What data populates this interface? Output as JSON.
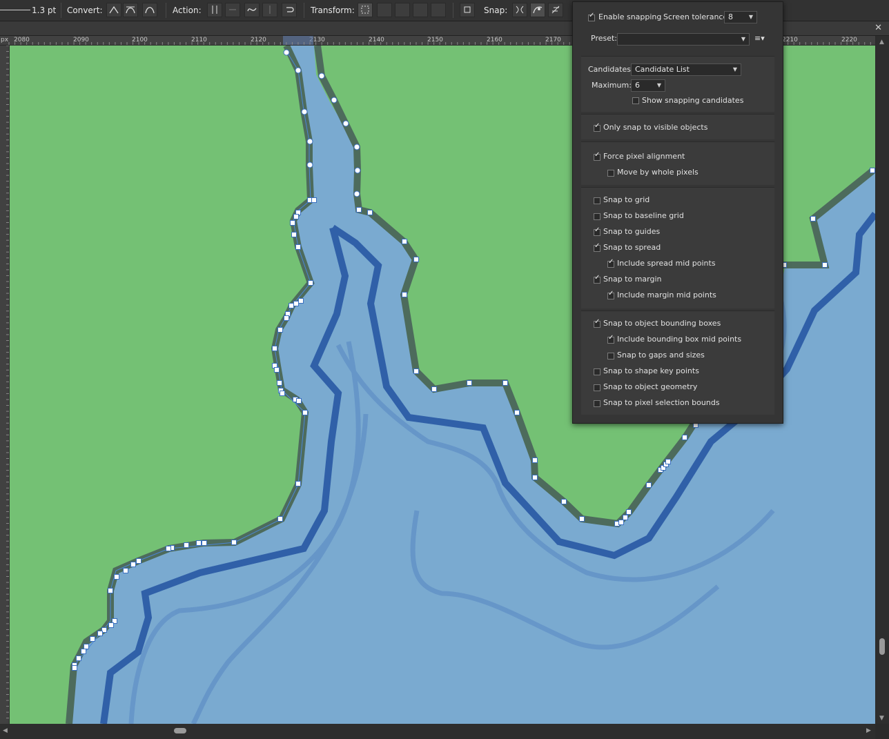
{
  "toolbar": {
    "stroke_width": "1.3 pt",
    "convert_label": "Convert:",
    "action_label": "Action:",
    "transform_label": "Transform:",
    "snap_label": "Snap:"
  },
  "ruler": {
    "unit": "px",
    "h_labels": [
      "2080",
      "2090",
      "2100",
      "2110",
      "2120",
      "2130",
      "2140",
      "2150",
      "2160",
      "2170",
      "2210",
      "2220"
    ]
  },
  "snapping": {
    "enable_label": "Enable snapping",
    "enable_checked": true,
    "tolerance_label": "Screen tolerance:",
    "tolerance_value": "8",
    "preset_label": "Preset:",
    "preset_value": "",
    "candidates_label": "Candidates:",
    "candidates_value": "Candidate List",
    "maximum_label": "Maximum:",
    "maximum_value": "6",
    "options": [
      {
        "label": "Show snapping candidates",
        "checked": false
      },
      {
        "label": "Only snap to visible objects",
        "checked": true
      },
      {
        "label": "Force pixel alignment",
        "checked": true
      },
      {
        "label": "Move by whole pixels",
        "checked": false
      },
      {
        "label": "Snap to grid",
        "checked": false
      },
      {
        "label": "Snap to baseline grid",
        "checked": false
      },
      {
        "label": "Snap to guides",
        "checked": true
      },
      {
        "label": "Snap to spread",
        "checked": true
      },
      {
        "label": "Include spread mid points",
        "checked": true
      },
      {
        "label": "Snap to margin",
        "checked": true
      },
      {
        "label": "Include margin mid points",
        "checked": true
      },
      {
        "label": "Snap to object bounding boxes",
        "checked": true
      },
      {
        "label": "Include bounding box mid points",
        "checked": true
      },
      {
        "label": "Snap to gaps and sizes",
        "checked": false
      },
      {
        "label": "Snap to shape key points",
        "checked": false
      },
      {
        "label": "Snap to object geometry",
        "checked": false
      },
      {
        "label": "Snap to pixel selection bounds",
        "checked": false
      }
    ]
  },
  "colors": {
    "land": "#74c174",
    "water": "#7aaad0",
    "coast": "#4d6b5c",
    "river": "#3060a8"
  }
}
